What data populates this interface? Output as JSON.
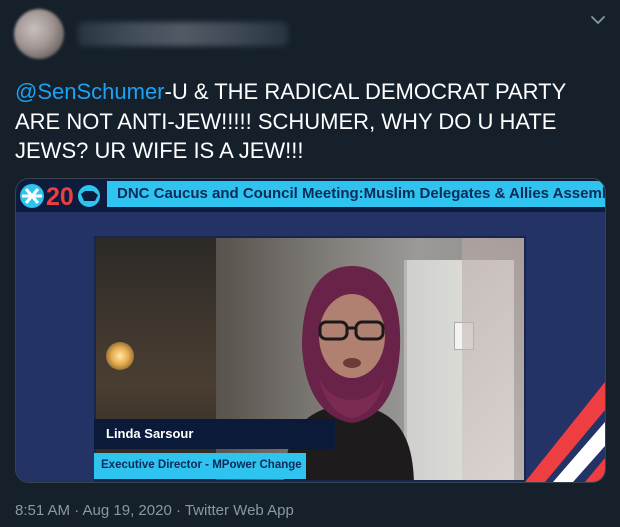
{
  "colors": {
    "background": "#15202b",
    "text": "#ffffff",
    "mention": "#1da1f2",
    "meta": "#8899a6",
    "banner_cyan": "#2ec4ef",
    "banner_navy": "#0d1b3d"
  },
  "tweet": {
    "mention": "@SenSchumer",
    "body": "-U & THE RADICAL DEMOCRAT PARTY ARE NOT ANTI-JEW!!!!! SCHUMER, WHY DO U HATE JEWS? UR WIFE IS A JEW!!!",
    "timestamp": "8:51 AM · Aug 19, 2020 · Twitter Web App"
  },
  "media": {
    "logo_text": "20",
    "banner_title": "DNC Caucus and Council Meeting:Muslim Delegates & Allies Assembly",
    "lower_third_name": "Linda Sarsour",
    "lower_third_role": "Executive Director - MPower Change"
  },
  "icons": {
    "menu": "chevron-down-icon",
    "logo": "dnc-logo"
  }
}
